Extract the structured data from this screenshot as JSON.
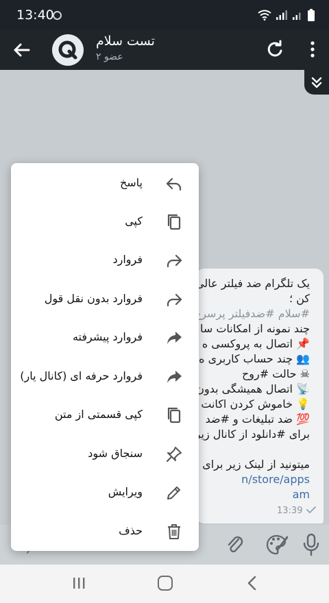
{
  "status_bar": {
    "time": "13:40"
  },
  "header": {
    "title": "تست سلام",
    "subtitle": "۲ عضو"
  },
  "message": {
    "lines": [
      {
        "text": "یک تلگرام ضد فیلتر عالی",
        "style": "normal"
      },
      {
        "text": "کن ؛",
        "style": "normal"
      },
      {
        "text": "#سلام #ضدفیلتر پرسرع",
        "style": "tag"
      },
      {
        "text": "چند نمونه از امکانات سا",
        "style": "normal"
      },
      {
        "text": "📌 اتصال به پروکسی ه",
        "style": "normal"
      },
      {
        "text": "👥 چند حساب کاربری ه",
        "style": "normal"
      },
      {
        "text": "☠ حالت #روح",
        "style": "normal"
      },
      {
        "text": "📡 اتصال همیشگی بدون",
        "style": "normal"
      },
      {
        "text": "💡 خاموش کردن اکانت",
        "style": "normal"
      },
      {
        "text": "💯 ضد تبلیغات و #ضد",
        "style": "normal"
      },
      {
        "text": "برای #دانلود از کانال زیر",
        "style": "normal"
      },
      {
        "text": "",
        "style": "normal"
      },
      {
        "text": "میتونید از لینک زیر برای",
        "style": "normal"
      },
      {
        "text": "n/store/apps",
        "style": "link"
      },
      {
        "text": "am",
        "style": "link"
      }
    ],
    "time": "13:39"
  },
  "context_menu": {
    "items": [
      {
        "label": "پاسخ",
        "icon": "reply-icon"
      },
      {
        "label": "کپی",
        "icon": "copy-icon"
      },
      {
        "label": "فروارد",
        "icon": "forward-icon"
      },
      {
        "label": "فروارد بدون نقل قول",
        "icon": "forward-icon"
      },
      {
        "label": "فروارد پیشرفته",
        "icon": "forward-filled-icon"
      },
      {
        "label": "فروارد حرفه ای (کانال یار)",
        "icon": "forward-filled-icon"
      },
      {
        "label": "کپی قسمتی از متن",
        "icon": "copy-icon"
      },
      {
        "label": "سنجاق شود",
        "icon": "pin-icon"
      },
      {
        "label": "ویرایش",
        "icon": "pencil-icon"
      },
      {
        "label": "حذف",
        "icon": "trash-icon"
      }
    ]
  },
  "colors": {
    "header_bg": "#202529",
    "chat_bg": "#c6ccd0",
    "menu_bg": "#ffffff",
    "link": "#3b6ea8",
    "hashtag": "#8a959c"
  }
}
